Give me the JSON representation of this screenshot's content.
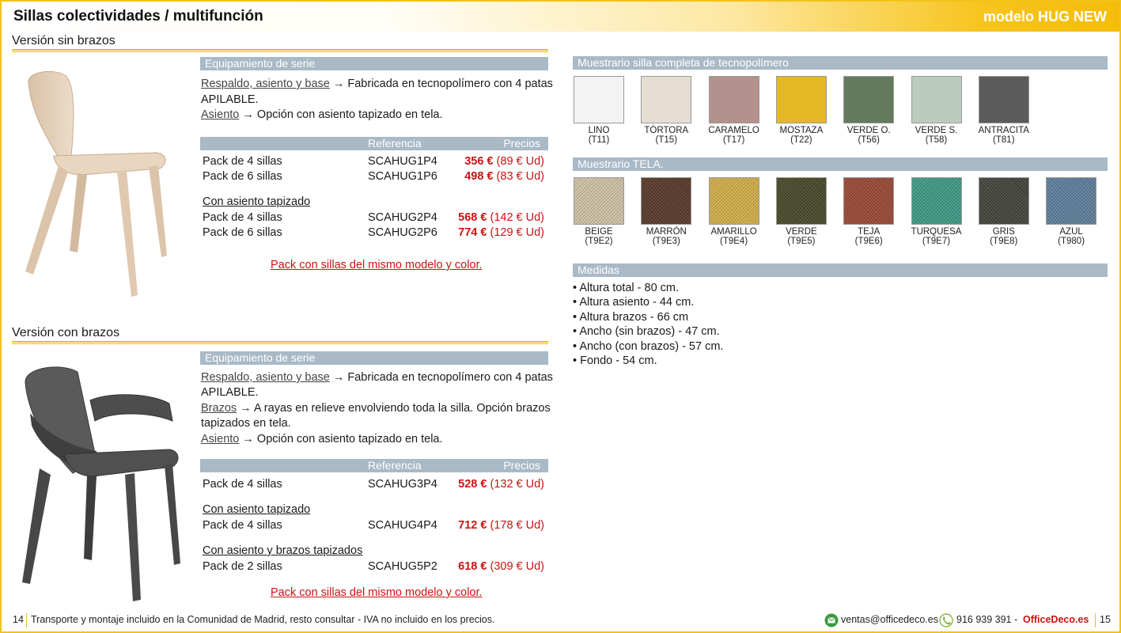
{
  "header": {
    "title": "Sillas colectividades / multifunción",
    "model": "modelo HUG NEW"
  },
  "section1": {
    "title": "Versión sin brazos",
    "equipment_title": "Equipamiento de serie",
    "line1_link": "Respaldo, asiento y base",
    "line1_text": "→ Fabricada en tecnopolímero con 4 patas",
    "line2": "APILABLE.",
    "line3_link": "Asiento",
    "line3_text": "→ Opción con asiento tapizado en tela.",
    "col_ref": "Referencia",
    "col_price": "Precios",
    "rows": [
      {
        "pack": "Pack de 4 sillas",
        "ref": "SCAHUG1P4",
        "price": "356 €",
        "unit": "(89 € Ud)"
      },
      {
        "pack": "Pack de 6 sillas",
        "ref": "SCAHUG1P6",
        "price": "498 €",
        "unit": "(83 € Ud)"
      }
    ],
    "subhead": "Con asiento tapizado",
    "rows2": [
      {
        "pack": "Pack de 4 sillas",
        "ref": "SCAHUG2P4",
        "price": "568 €",
        "unit": "(142 € Ud)"
      },
      {
        "pack": "Pack de 6 sillas",
        "ref": "SCAHUG2P6",
        "price": "774 €",
        "unit": "(129 € Ud)"
      }
    ],
    "note": "Pack con sillas del mismo modelo y color."
  },
  "section2": {
    "title": "Versión con brazos",
    "equipment_title": "Equipamiento de serie",
    "line1_link": "Respaldo, asiento y base",
    "line1_text": "→ Fabricada en tecnopolímero con 4 patas",
    "line2": "APILABLE.",
    "line3_link": "Brazos",
    "line3_text": "→ A rayas en relieve envolviendo toda la silla. Opción brazos",
    "line4": "tapizados en tela.",
    "line5_link": "Asiento",
    "line5_text": "→ Opción con asiento tapizado en tela.",
    "col_ref": "Referencia",
    "col_price": "Precios",
    "row_a": {
      "pack": "Pack de 4 sillas",
      "ref": "SCAHUG3P4",
      "price": "528 €",
      "unit": "(132 € Ud)"
    },
    "subhead_b": "Con asiento tapizado",
    "row_b": {
      "pack": "Pack de 4 sillas",
      "ref": "SCAHUG4P4",
      "price": "712 €",
      "unit": "(178 € Ud)"
    },
    "subhead_c": "Con asiento y brazos tapizados",
    "row_c": {
      "pack": "Pack de 2 sillas",
      "ref": "SCAHUG5P2",
      "price": "618 €",
      "unit": "(309 € Ud)"
    },
    "note": "Pack con sillas del mismo modelo y color."
  },
  "muestrario_poly": {
    "title": "Muestrario silla completa de tecnopolímero",
    "items": [
      {
        "name": "LINO",
        "code": "(T11)",
        "color": "#f3f3f3"
      },
      {
        "name": "TÓRTORA",
        "code": "(T15)",
        "color": "#e6ddd2"
      },
      {
        "name": "CARAMELO",
        "code": "(T17)",
        "color": "#b3918c"
      },
      {
        "name": "MOSTAZA",
        "code": "(T22)",
        "color": "#e3b825"
      },
      {
        "name": "VERDE O.",
        "code": "(T56)",
        "color": "#647a5c"
      },
      {
        "name": "VERDE S.",
        "code": "(T58)",
        "color": "#bccbbf"
      },
      {
        "name": "ANTRACITA",
        "code": "(T81)",
        "color": "#5b5b5b"
      }
    ]
  },
  "muestrario_tela": {
    "title": "Muestrario TELA.",
    "items": [
      {
        "name": "BEIGE",
        "code": "(T9E2)",
        "color": "#cfc2a6"
      },
      {
        "name": "MARRÓN",
        "code": "(T9E3)",
        "color": "#5a3b2c"
      },
      {
        "name": "AMARILLO",
        "code": "(T9E4)",
        "color": "#d2ae4a"
      },
      {
        "name": "VERDE",
        "code": "(T9E5)",
        "color": "#4a4a2c"
      },
      {
        "name": "TEJA",
        "code": "(T9E6)",
        "color": "#9a4a38"
      },
      {
        "name": "TURQUESA",
        "code": "(T9E7)",
        "color": "#3f9b86"
      },
      {
        "name": "GRIS",
        "code": "(T9E8)",
        "color": "#44463e"
      },
      {
        "name": "AZUL",
        "code": "(T980)",
        "color": "#5f7f9c"
      }
    ]
  },
  "medidas": {
    "title": "Medidas",
    "items": [
      "Altura total - 80 cm.",
      "Altura asiento - 44 cm.",
      "Altura brazos - 66 cm",
      "Ancho (sin brazos) - 47 cm.",
      "Ancho (con brazos) - 57 cm.",
      "Fondo - 54 cm."
    ]
  },
  "footer": {
    "page_left": "14",
    "text": "Transporte y montaje incluido en la Comunidad de Madrid, resto consultar - IVA no incluido en los precios.",
    "email": "ventas@officedeco.es",
    "phone": "916 939 391",
    "dash": "-",
    "brand": "OfficeDeco.es",
    "page_right": "15"
  },
  "colors": {
    "accent": "#f2bd1b",
    "bar": "#a9b9c6",
    "price": "#cc1313"
  }
}
